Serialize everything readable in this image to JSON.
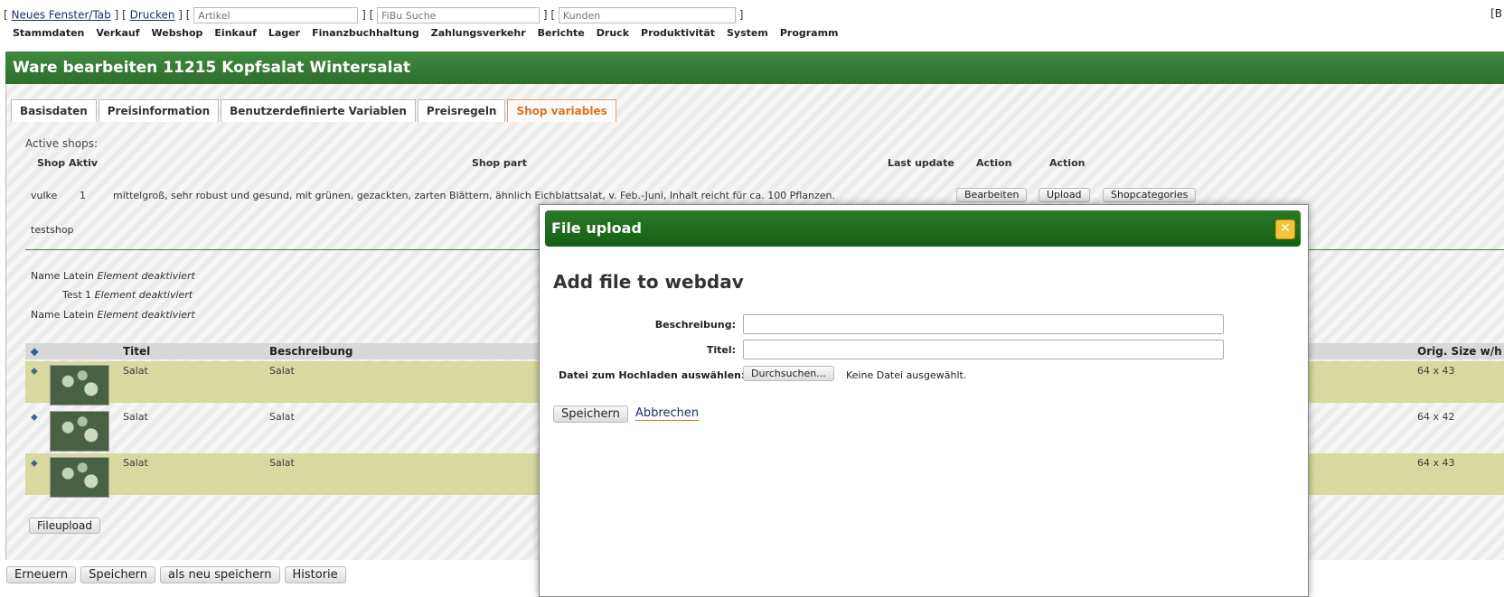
{
  "topbar": {
    "new_window_link": "Neues Fenster/Tab",
    "print_link": "Drucken",
    "article_placeholder": "Artikel",
    "fibu_placeholder": "FiBu Suche",
    "customers_placeholder": "Kunden",
    "right_fragment": "[B"
  },
  "menu": [
    "Stammdaten",
    "Verkauf",
    "Webshop",
    "Einkauf",
    "Lager",
    "Finanzbuchhaltung",
    "Zahlungsverkehr",
    "Berichte",
    "Druck",
    "Produktivität",
    "System",
    "Programm"
  ],
  "title": "Ware bearbeiten 11215 Kopfsalat Wintersalat",
  "tabs": [
    {
      "label": "Basisdaten",
      "active": false
    },
    {
      "label": "Preisinformation",
      "active": false
    },
    {
      "label": "Benutzerdefinierte Variablen",
      "active": false
    },
    {
      "label": "Preisregeln",
      "active": false
    },
    {
      "label": "Shop variables",
      "active": true
    }
  ],
  "shops": {
    "section_label": "Active shops:",
    "headers": {
      "shop": "Shop",
      "aktiv": "Aktiv",
      "shop_part": "Shop part",
      "last_update": "Last update",
      "action1": "Action",
      "action2": "Action"
    },
    "rows": [
      {
        "shop": "vulke",
        "aktiv": "1",
        "shop_part": "mittelgroß, sehr robust und gesund, mit grünen, gezackten, zarten Blättern, ähnlich Eichblattsalat, v. Feb.-Juni, Inhalt reicht für ca. 100 Pflanzen.",
        "btn_edit": "Bearbeiten",
        "btn_upload": "Upload",
        "btn_categories": "Shopcategories"
      },
      {
        "shop": "testshop",
        "aktiv": "",
        "shop_part": ""
      }
    ]
  },
  "fields": [
    {
      "label": "Name Latein",
      "value": "Element deaktiviert"
    },
    {
      "label": "Test 1",
      "value": "Element deaktiviert"
    },
    {
      "label": "Name Latein",
      "value": "Element deaktiviert"
    }
  ],
  "images": {
    "headers": {
      "titel": "Titel",
      "beschreibung": "Beschreibung",
      "orig_size": "Orig. Size w/h"
    },
    "rows": [
      {
        "titel": "Salat",
        "beschreibung": "Salat",
        "size": "64 x 43"
      },
      {
        "titel": "Salat",
        "beschreibung": "Salat",
        "size": "64 x 42"
      },
      {
        "titel": "Salat",
        "beschreibung": "Salat",
        "size": "64 x 43"
      }
    ],
    "fileupload_button": "Fileupload"
  },
  "bottom_buttons": [
    "Erneuern",
    "Speichern",
    "als neu speichern",
    "Historie"
  ],
  "modal": {
    "title": "File upload",
    "close_icon": "close-icon",
    "heading": "Add file to webdav",
    "desc_label": "Beschreibung:",
    "desc_value": "",
    "title_label": "Titel:",
    "title_value": "",
    "file_label": "Datei zum Hochladen auswählen:",
    "browse_button": "Durchsuchen...",
    "no_file_text": "Keine Datei ausgewählt.",
    "save_button": "Speichern",
    "cancel_link": "Abbrechen"
  },
  "colors": {
    "title_green": "#3a7d3a",
    "modal_green": "#1f6b1f",
    "active_tab": "#e07020",
    "row_highlight": "#d6d89a",
    "close_yellow": "#f3c43b"
  }
}
